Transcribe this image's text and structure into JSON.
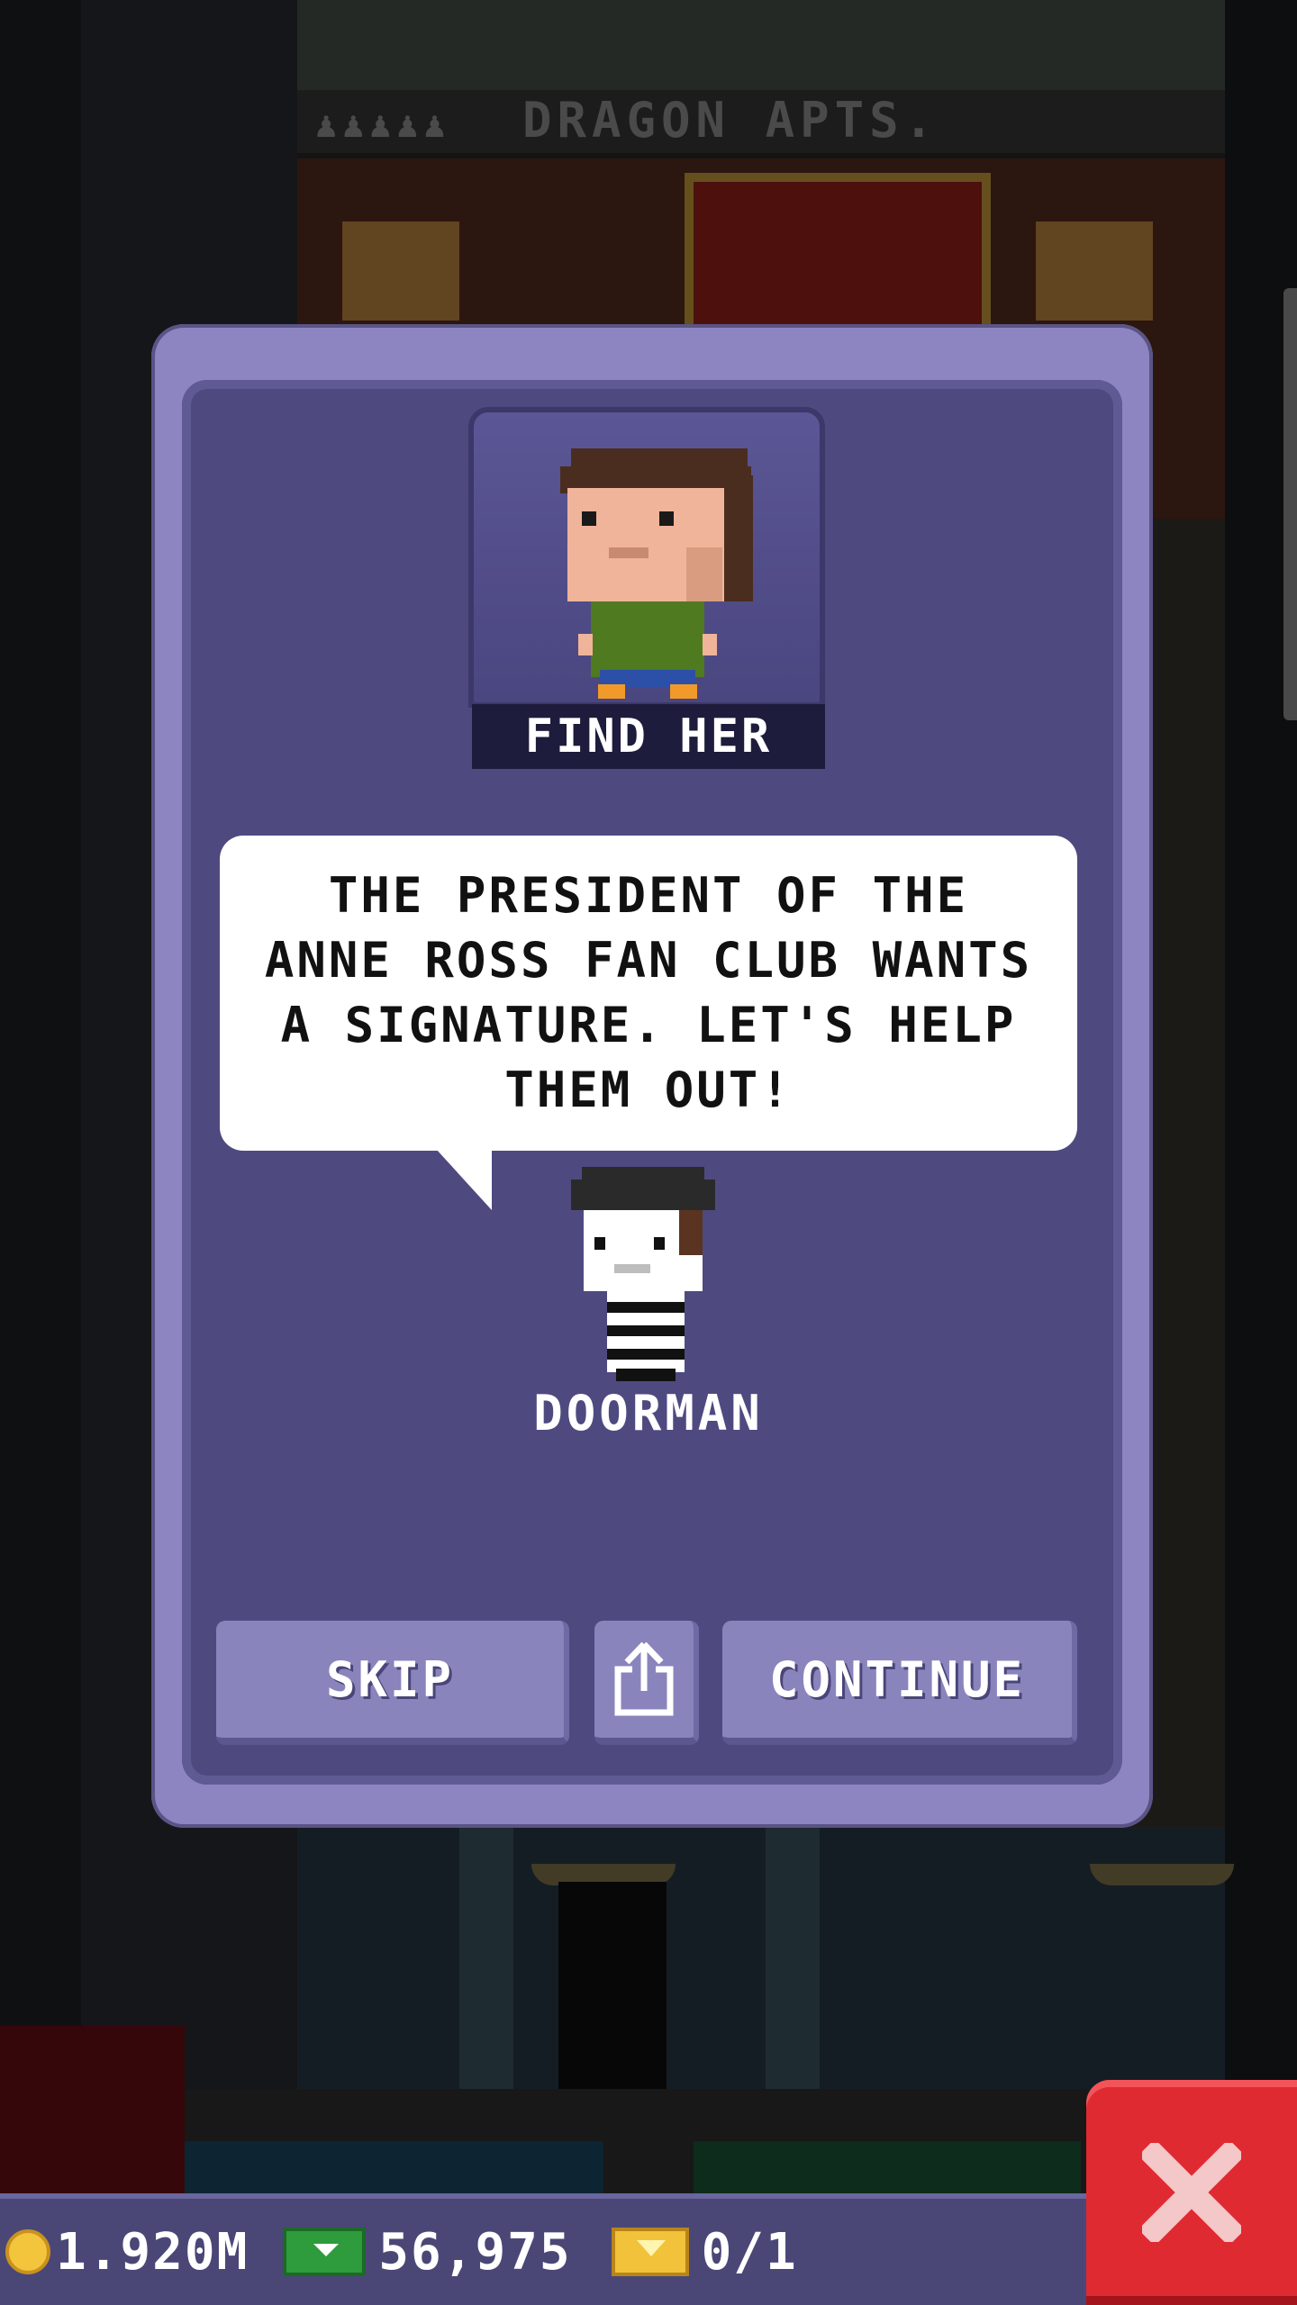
{
  "background": {
    "building_sign": "DRAGON APTS."
  },
  "dialog": {
    "mission_title": "FIND HER",
    "message": "THE PRESIDENT OF THE ANNE ROSS FAN CLUB WANTS A SIGNATURE. LET'S HELP THEM OUT!",
    "npc_name": "DOORMAN",
    "buttons": {
      "skip": "SKIP",
      "share_icon": "share-icon",
      "continue": "CONTINUE"
    }
  },
  "hud": {
    "coins": "1.920M",
    "bux": "56,975",
    "tickets": "0/1"
  },
  "close_button": {
    "icon": "close-icon"
  },
  "colors": {
    "dialog_frame": "#8c85c2",
    "dialog_body": "#4e4a80",
    "button": "#8a84bd",
    "close_red": "#e02a32"
  }
}
